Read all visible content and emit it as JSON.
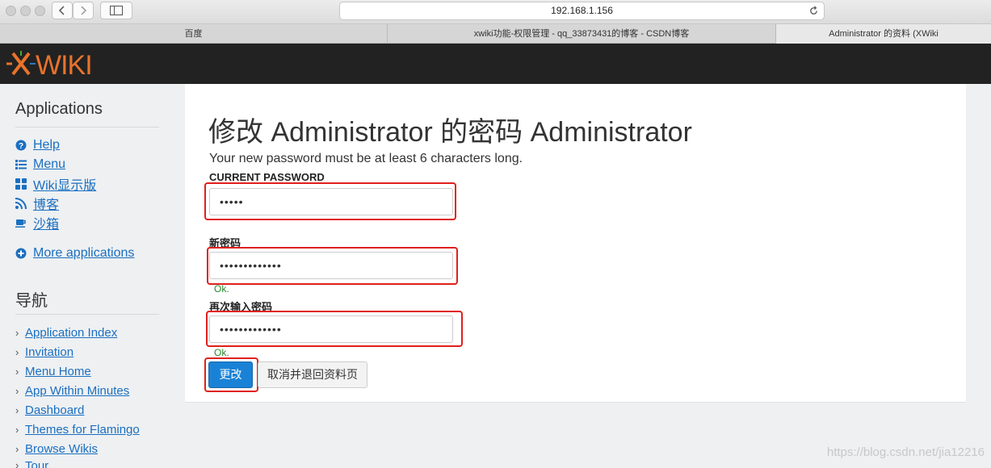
{
  "browser": {
    "url": "192.168.1.156",
    "tabs": [
      {
        "label": "百度"
      },
      {
        "label": "xwiki功能-权限管理 - qq_33873431的博客 - CSDN博客"
      },
      {
        "label": "Administrator 的资料 (XWiki"
      }
    ]
  },
  "header": {
    "logo_text": "WIKI"
  },
  "sidebar": {
    "applications_title": "Applications",
    "apps": [
      {
        "label": "Help",
        "icon": "question-circle-icon"
      },
      {
        "label": "Menu",
        "icon": "list-icon"
      },
      {
        "label": "Wiki显示版",
        "icon": "grid-icon"
      },
      {
        "label": "博客",
        "icon": "rss-icon"
      },
      {
        "label": "沙箱",
        "icon": "coffee-icon"
      }
    ],
    "more_apps": {
      "label": "More applications",
      "icon": "plus-circle-icon"
    },
    "nav_title": "导航",
    "nav": [
      {
        "label": "Application Index"
      },
      {
        "label": "Invitation"
      },
      {
        "label": "Menu Home"
      },
      {
        "label": "App Within Minutes"
      },
      {
        "label": "Dashboard"
      },
      {
        "label": "Themes for Flamingo"
      },
      {
        "label": "Browse Wikis"
      },
      {
        "label": "Tour"
      }
    ]
  },
  "form": {
    "title": "修改 Administrator 的密码 Administrator",
    "hint": "Your new password must be at least 6 characters long.",
    "current_label": "CURRENT PASSWORD",
    "current_value": "•••••",
    "new_label": "新密码",
    "new_value": "•••••••••••••",
    "new_status": "Ok.",
    "confirm_label": "再次输入密码",
    "confirm_value": "•••••••••••••",
    "confirm_status": "Ok.",
    "submit_label": "更改",
    "cancel_label": "取消并退回资料页"
  },
  "watermark": "https://blog.csdn.net/jia12216",
  "colors": {
    "accent": "#1a82d6",
    "highlight": "#e0201c",
    "logo": "#e8732b",
    "link": "#1b6fc0"
  }
}
